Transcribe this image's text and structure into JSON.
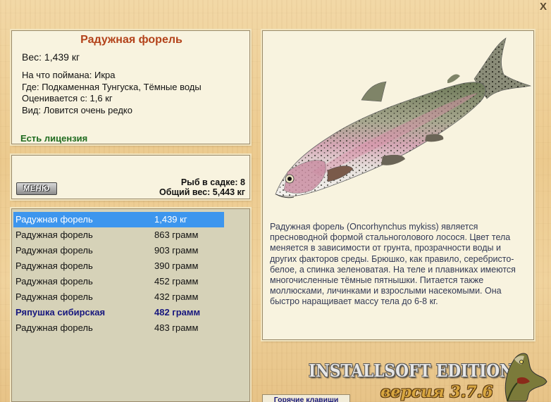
{
  "window": {
    "close": "X"
  },
  "fish": {
    "name": "Радужная форель",
    "weight_line": "Вес: 1,439 кг",
    "bait_line": "На что поймана: Икра",
    "location_line": "Где: Подкаменная Тунгуска, Тёмные воды",
    "price_line": "Оценивается с: 1,6 кг",
    "rarity_line": "Вид: Ловится очень редко",
    "license": "Есть лицензия",
    "description": "Радужная форель (Oncorhynchus mykiss) является пресноводной формой стальноголового лосося. Цвет тела меняется в зависимости от грунта, прозрачности воды и других факторов среды. Брюшко, как правило, серебристо-белое, а спинка зеленоватая. На теле и плавниках имеются многочисленные тёмные пятнышки. Питается также моллюсками, личинками и взрослыми насекомыми. Она быстро наращивает массу тела до 6-8 кг."
  },
  "summary": {
    "menu_button": "МЕНЮ",
    "fish_count": "Рыб в садке: 8",
    "total_weight": "Общий вес: 5,443 кг"
  },
  "catch_list": [
    {
      "name": "Радужная форель",
      "weight": "1,439 кг",
      "selected": true
    },
    {
      "name": "Радужная форель",
      "weight": "863 грамм"
    },
    {
      "name": "Радужная форель",
      "weight": "903 грамм"
    },
    {
      "name": "Радужная форель",
      "weight": "390 грамм"
    },
    {
      "name": "Радужная форель",
      "weight": "452 грамм"
    },
    {
      "name": "Радужная форель",
      "weight": "432 грамм"
    },
    {
      "name": "Ряпушка сибирская",
      "weight": "482 грамм",
      "special": true
    },
    {
      "name": "Радужная форель",
      "weight": "483 грамм"
    }
  ],
  "footer": {
    "hotkeys_button": "Горячие клавиши",
    "brand": "INSTALLSOFT EDITION",
    "version": "версия 3.7.6"
  },
  "colors": {
    "title": "#b3421a",
    "license": "#1f6b1f",
    "selected_row": "#3d96ee",
    "special_row": "#17177e"
  },
  "icons": {
    "fish_picture": "rainbow-trout-image",
    "logo": "pike-icon"
  }
}
